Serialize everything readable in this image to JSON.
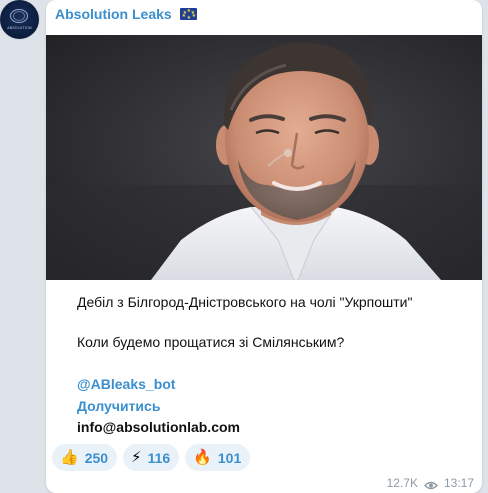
{
  "channel": {
    "avatar_icon": "channel-logo",
    "avatar_text": "ABSOLUTION",
    "name": "Absolution Leaks",
    "flag_icon": "eu-flag-icon"
  },
  "post": {
    "image_description_icon": "photo",
    "headline": "Дебіл з Білгород-Дністровського на чолі \"Укрпошти\"",
    "question": "Коли будемо прощатися зі Смілянським?",
    "bot_link": "@ABleaks_bot",
    "join_link": "Долучитись",
    "email": "info@absolutionlab.com"
  },
  "reactions": [
    {
      "icon": "thumbs-up-icon",
      "emoji": "👍",
      "count": "250"
    },
    {
      "icon": "lightning-icon",
      "emoji": "⚡",
      "count": "116"
    },
    {
      "icon": "fire-icon",
      "emoji": "🔥",
      "count": "101"
    }
  ],
  "meta": {
    "views": "12.7K",
    "time": "13:17",
    "views_icon": "eye-icon"
  },
  "colors": {
    "accent": "#3b8fce",
    "background": "#dde3e8",
    "bubble": "#ffffff",
    "reaction_bg": "#e9f1f9",
    "meta_text": "#8e9aa5"
  }
}
